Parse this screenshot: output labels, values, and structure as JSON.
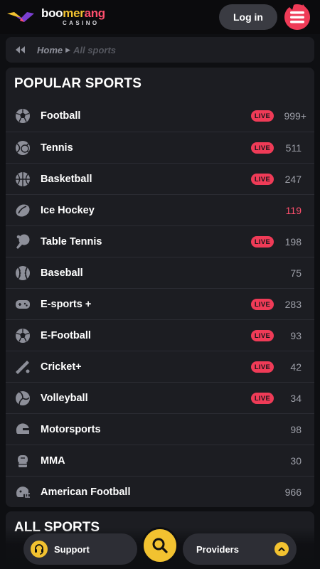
{
  "header": {
    "logo": {
      "part1": "boo",
      "part2": "mer",
      "part3": "ang",
      "sub": "CASINO"
    },
    "login_label": "Log in"
  },
  "breadcrumb": {
    "home": "Home",
    "current": "All sports"
  },
  "popular": {
    "title": "POPULAR SPORTS",
    "live_label": "LIVE",
    "sports": [
      {
        "name": "Football",
        "count": "999+",
        "live": true,
        "icon": "soccer-ball-icon"
      },
      {
        "name": "Tennis",
        "count": "511",
        "live": true,
        "icon": "tennis-ball-icon"
      },
      {
        "name": "Basketball",
        "count": "247",
        "live": true,
        "icon": "basketball-icon"
      },
      {
        "name": "Ice Hockey",
        "count": "119",
        "live": false,
        "icon": "hockey-puck-icon",
        "count_color": "#ff4f6d"
      },
      {
        "name": "Table Tennis",
        "count": "198",
        "live": true,
        "icon": "table-tennis-icon"
      },
      {
        "name": "Baseball",
        "count": "75",
        "live": false,
        "icon": "baseball-icon"
      },
      {
        "name": "E-sports +",
        "count": "283",
        "live": true,
        "icon": "gamepad-icon"
      },
      {
        "name": "E-Football",
        "count": "93",
        "live": true,
        "icon": "soccer-ball-icon"
      },
      {
        "name": "Cricket+",
        "count": "42",
        "live": true,
        "icon": "cricket-bat-icon"
      },
      {
        "name": "Volleyball",
        "count": "34",
        "live": true,
        "icon": "volleyball-icon"
      },
      {
        "name": "Motorsports",
        "count": "98",
        "live": false,
        "icon": "helmet-icon"
      },
      {
        "name": "MMA",
        "count": "30",
        "live": false,
        "icon": "mma-glove-icon"
      },
      {
        "name": "American Football",
        "count": "966",
        "live": false,
        "icon": "football-helmet-icon"
      }
    ]
  },
  "all_sports": {
    "title": "ALL SPORTS"
  },
  "bottom_bar": {
    "support_label": "Support",
    "providers_label": "Providers"
  },
  "colors": {
    "accent_yellow": "#f2c230",
    "live_red": "#ef3b57",
    "card_bg": "#1c1d22",
    "page_bg": "#0e0f12"
  }
}
